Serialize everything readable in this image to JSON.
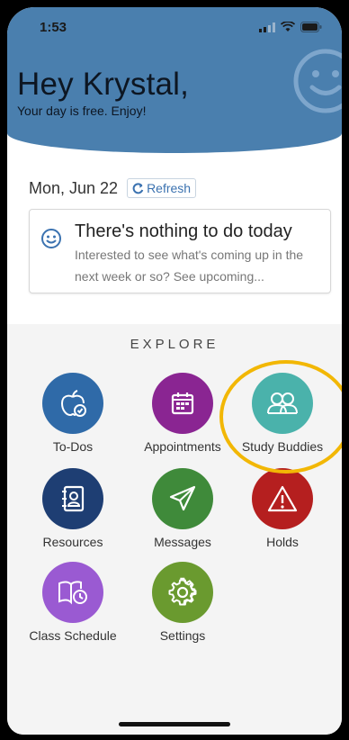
{
  "status": {
    "time": "1:53"
  },
  "header": {
    "greeting": "Hey Krystal,",
    "subtitle": "Your day is free. Enjoy!"
  },
  "date": {
    "label": "Mon, Jun 22",
    "refresh_label": "Refresh"
  },
  "card": {
    "title": "There's nothing to do today",
    "body": "Interested to see what's coming up in the next week or so? See upcoming..."
  },
  "explore": {
    "title": "EXPLORE",
    "tiles": [
      {
        "label": "To-Dos",
        "icon": "apple-check-icon",
        "color": "#2f6aa8"
      },
      {
        "label": "Appointments",
        "icon": "calendar-icon",
        "color": "#8a2592"
      },
      {
        "label": "Study Buddies",
        "icon": "people-icon",
        "color": "#4ab2ab"
      },
      {
        "label": "Resources",
        "icon": "contact-book-icon",
        "color": "#1e3e73"
      },
      {
        "label": "Messages",
        "icon": "paper-plane-icon",
        "color": "#3f8a3a"
      },
      {
        "label": "Holds",
        "icon": "warning-icon",
        "color": "#b51f1f"
      },
      {
        "label": "Class Schedule",
        "icon": "book-clock-icon",
        "color": "#9a5ad2"
      },
      {
        "label": "Settings",
        "icon": "gear-icon",
        "color": "#6a9a2f"
      }
    ]
  },
  "colors": {
    "header": "#4a7fae",
    "highlight": "#f2b705",
    "accent": "#3b72b0"
  }
}
